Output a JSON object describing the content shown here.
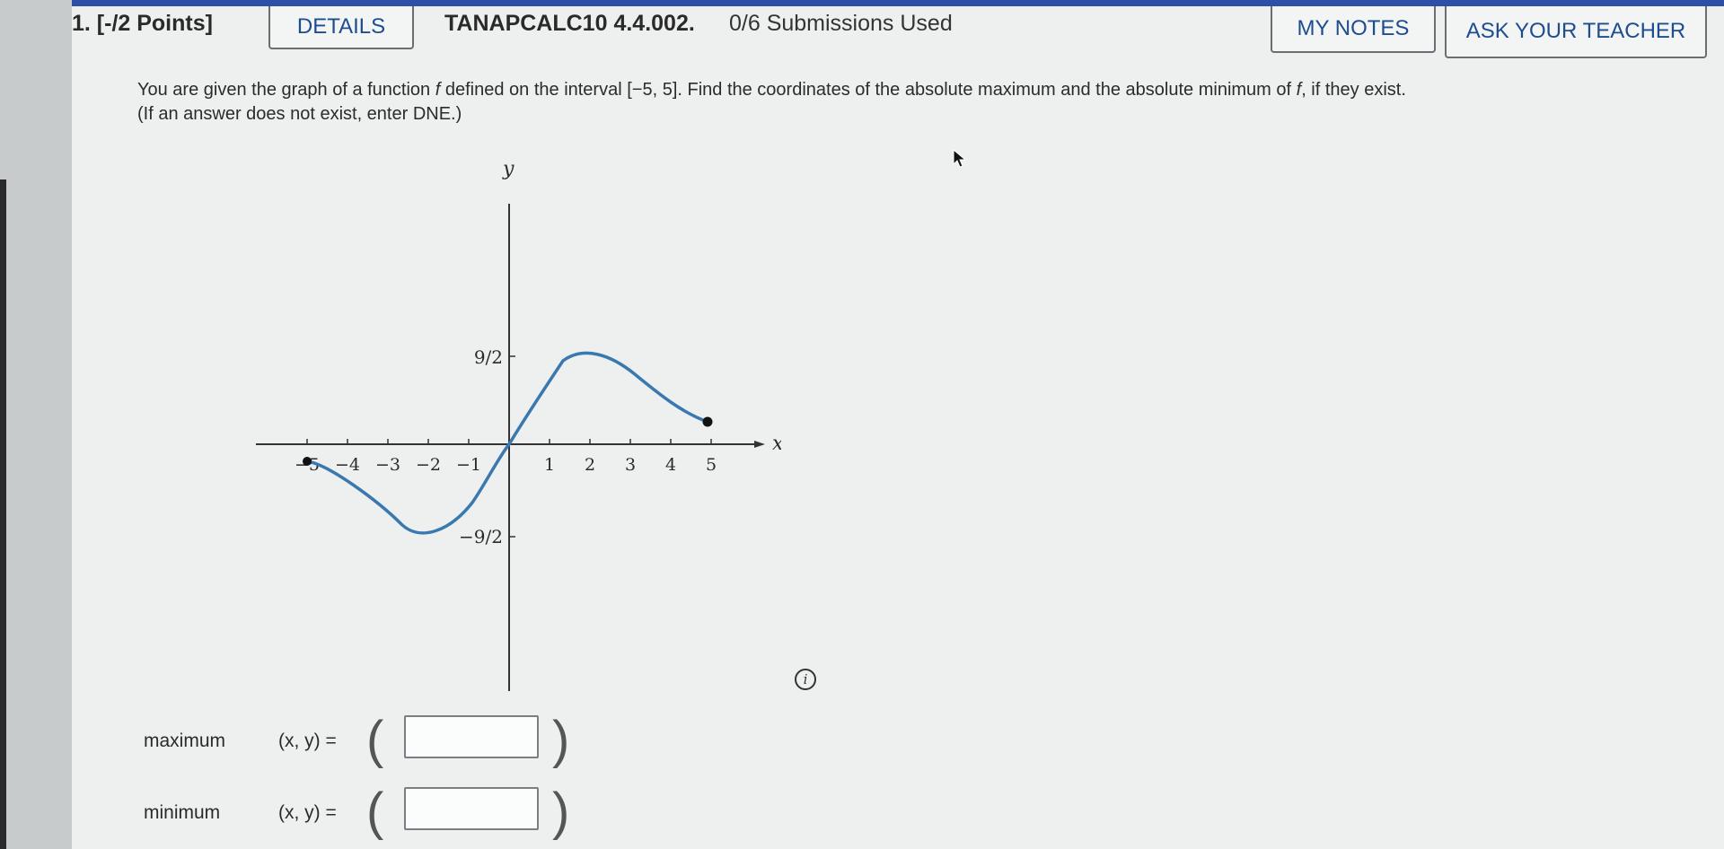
{
  "header": {
    "points": "1. [-/2 Points]",
    "details_label": "DETAILS",
    "problem_code": "TANAPCALC10 4.4.002.",
    "submissions": "0/6 Submissions Used",
    "my_notes_label": "MY NOTES",
    "ask_teacher_label": "ASK YOUR TEACHER"
  },
  "question": {
    "part1": "You are given the graph of a function ",
    "fname": "f",
    "part2": " defined on the interval [−5, 5]. Find the coordinates of the absolute maximum and the absolute minimum of ",
    "fname2": "f",
    "part3": ", if they exist.",
    "line2": "(If an answer does not exist, enter DNE.)"
  },
  "graph": {
    "x_axis_label": "x",
    "y_axis_label": "y",
    "x_ticks": [
      "−5",
      "−4",
      "−3",
      "−2",
      "−1",
      "1",
      "2",
      "3",
      "4",
      "5"
    ],
    "y_tick_top": "9/2",
    "y_tick_bottom": "−9/2",
    "curve_color": "#3a78b0"
  },
  "answers": {
    "maximum_label": "maximum",
    "minimum_label": "minimum",
    "xy_text": "(x, y) =",
    "open_paren": "(",
    "close_paren": ")",
    "maximum_value": "",
    "minimum_value": ""
  },
  "info_icon": "i"
}
